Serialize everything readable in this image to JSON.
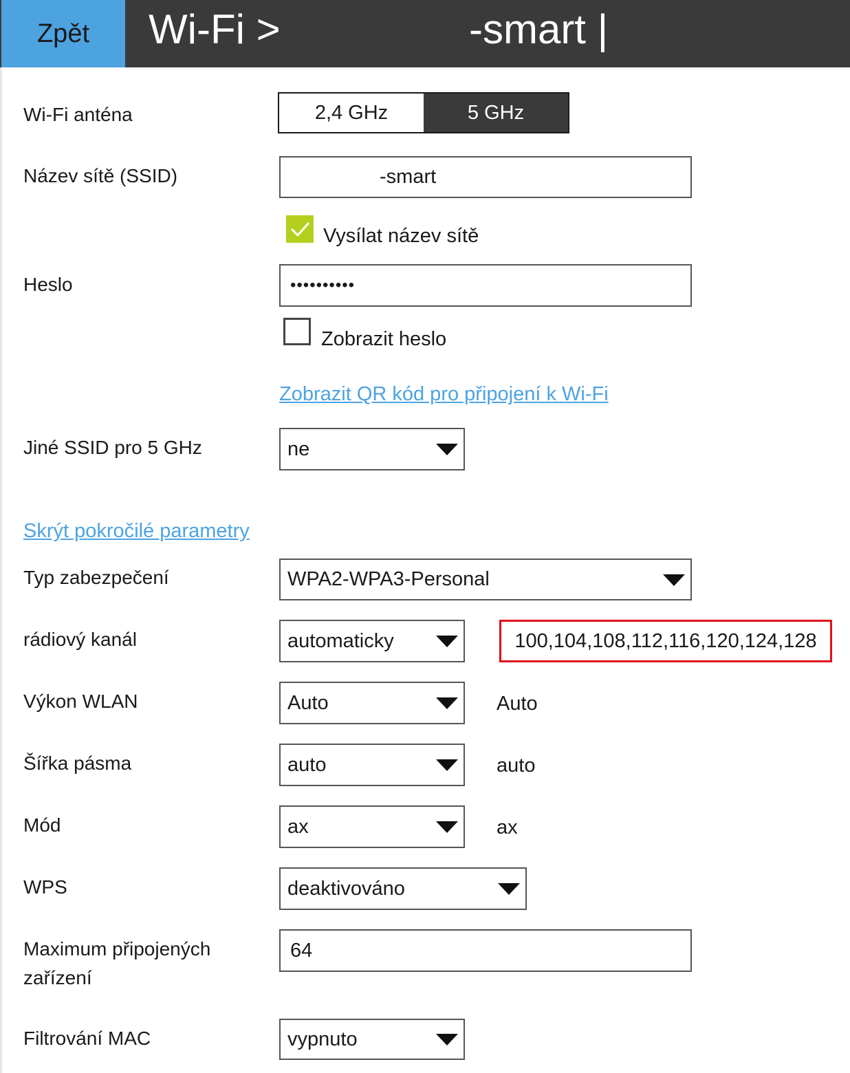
{
  "header": {
    "back_label": "Zpět",
    "title": "Wi-Fi >",
    "ssid": "-smart |"
  },
  "antenna": {
    "label": "Wi-Fi anténa",
    "options": [
      "2,4 GHz",
      "5 GHz"
    ],
    "selected": "5 GHz"
  },
  "ssid": {
    "label": "Název sítě (SSID)",
    "value": "-smart"
  },
  "broadcast": {
    "label": "Vysílat název sítě",
    "checked": true
  },
  "password": {
    "label": "Heslo",
    "value": "••••••••••"
  },
  "show_password": {
    "label": "Zobrazit heslo",
    "checked": false
  },
  "qr_link": "Zobrazit QR kód pro připojení k Wi-Fi",
  "other_ssid": {
    "label": "Jiné SSID pro 5 GHz",
    "value": "ne"
  },
  "advanced_link": "Skrýt pokročilé parametry",
  "security": {
    "label": "Typ zabezpečení",
    "value": "WPA2-WPA3-Personal"
  },
  "channel": {
    "label": "rádiový kanál",
    "value": "automaticky",
    "current": "100,104,108,112,116,120,124,128"
  },
  "power": {
    "label": "Výkon WLAN",
    "value": "Auto",
    "current": "Auto"
  },
  "bandwidth": {
    "label": "Šířka pásma",
    "value": "auto",
    "current": "auto"
  },
  "mode": {
    "label": "Mód",
    "value": "ax",
    "current": "ax"
  },
  "wps": {
    "label": "WPS",
    "value": "deaktivováno"
  },
  "max_devices": {
    "label_line1": "Maximum připojených",
    "label_line2": "zařízení",
    "value": "64"
  },
  "mac_filter": {
    "label": "Filtrování MAC",
    "value": "vypnuto"
  },
  "colors": {
    "header_bg": "#3a3a3a",
    "back_bg": "#4da3e0",
    "link": "#4da3e0",
    "checkbox_checked": "#b5cf1e",
    "highlight_border": "#e0101a"
  }
}
